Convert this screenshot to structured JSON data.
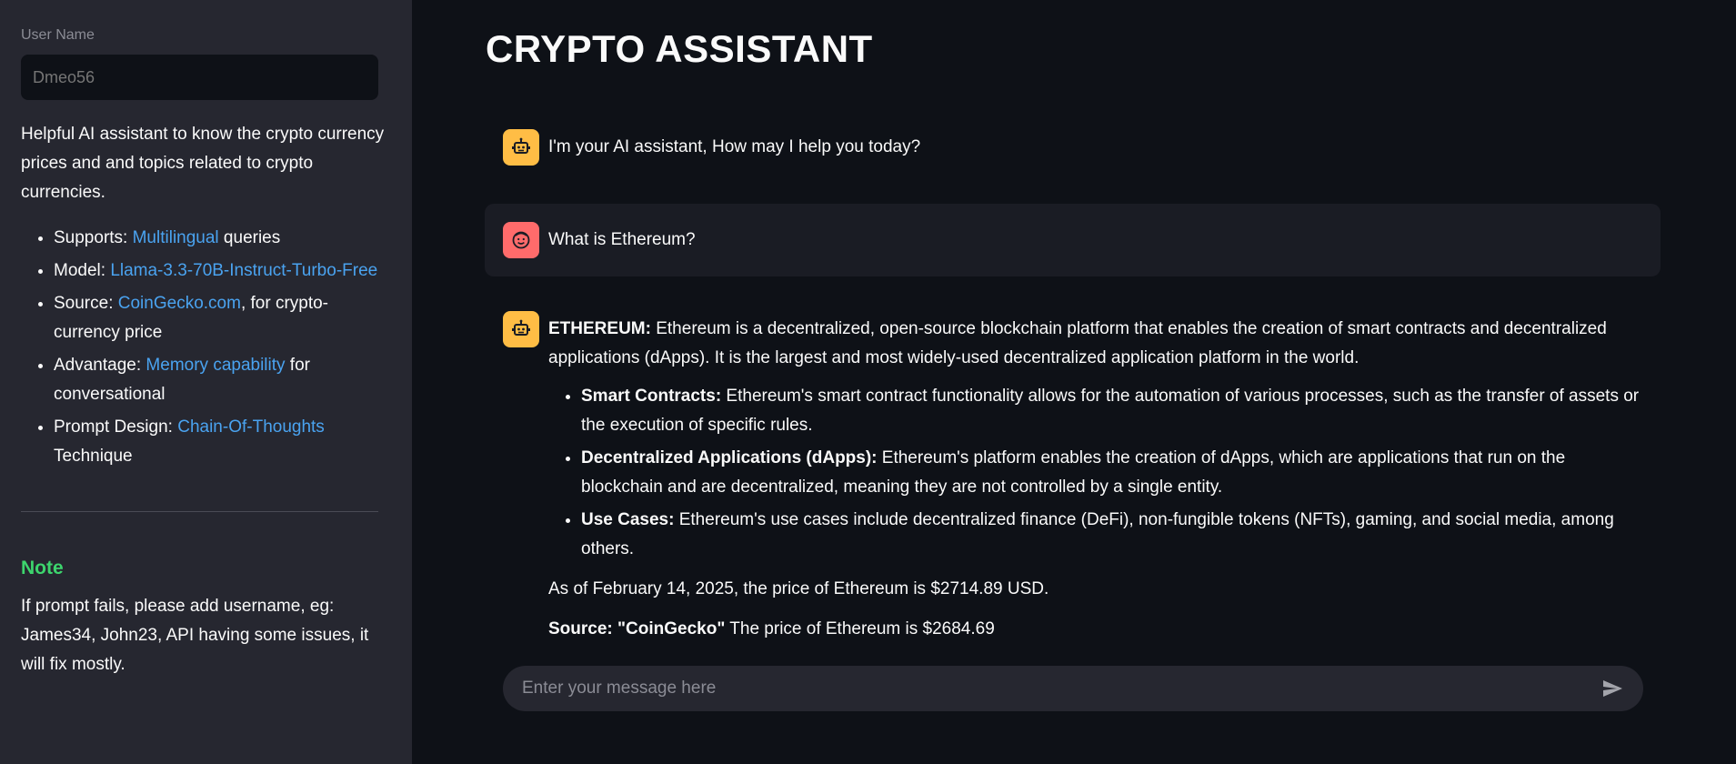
{
  "sidebar": {
    "user_label": "User Name",
    "user_value": "Dmeo56",
    "description": "Helpful AI assistant to know the crypto currency prices and and topics related to crypto currencies.",
    "features": [
      {
        "prefix": "Supports: ",
        "link": "Multilingual",
        "suffix": " queries"
      },
      {
        "prefix": "Model: ",
        "link": "Llama-3.3-70B-Instruct-Turbo-Free",
        "suffix": ""
      },
      {
        "prefix": "Source: ",
        "link": "CoinGecko.com",
        "suffix": ", for crypto-currency price"
      },
      {
        "prefix": "Advantage: ",
        "link": "Memory capability",
        "suffix": " for conversational"
      },
      {
        "prefix": "Prompt Design: ",
        "link": "Chain-Of-Thoughts",
        "suffix": " Technique"
      }
    ],
    "note_title": "Note",
    "note_text": "If prompt fails, please add username, eg: James34, John23, API having some issues, it will fix mostly."
  },
  "main": {
    "title": "CRYPTO ASSISTANT",
    "messages": [
      {
        "role": "assistant",
        "text": "I'm your AI assistant, How may I help you today?"
      },
      {
        "role": "user",
        "text": "What is Ethereum?"
      }
    ],
    "response": {
      "intro_bold": "ETHEREUM:",
      "intro_text": " Ethereum is a decentralized, open-source blockchain platform that enables the creation of smart contracts and decentralized applications (dApps). It is the largest and most widely-used decentralized application platform in the world.",
      "bullets": [
        {
          "bold": "Smart Contracts:",
          "text": " Ethereum's smart contract functionality allows for the automation of various processes, such as the transfer of assets or the execution of specific rules."
        },
        {
          "bold": "Decentralized Applications (dApps):",
          "text": " Ethereum's platform enables the creation of dApps, which are applications that run on the blockchain and are decentralized, meaning they are not controlled by a single entity."
        },
        {
          "bold": "Use Cases:",
          "text": " Ethereum's use cases include decentralized finance (DeFi), non-fungible tokens (NFTs), gaming, and social media, among others."
        }
      ],
      "price_line": "As of February 14, 2025, the price of Ethereum is $2714.89 USD.",
      "source_bold": "Source: \"CoinGecko\"",
      "source_text": " The price of Ethereum is $2684.69"
    },
    "chat_input_placeholder": "Enter your message here"
  },
  "colors": {
    "sidebar_bg": "#262730",
    "main_bg": "#0e1117",
    "link": "#4aa3f0",
    "note": "#3dd56d",
    "bot_avatar": "#ffbd45",
    "user_avatar": "#ff6b6b"
  },
  "icons": {
    "assistant_avatar": "robot-icon",
    "user_avatar": "smiley-face-icon",
    "send": "send-icon"
  }
}
